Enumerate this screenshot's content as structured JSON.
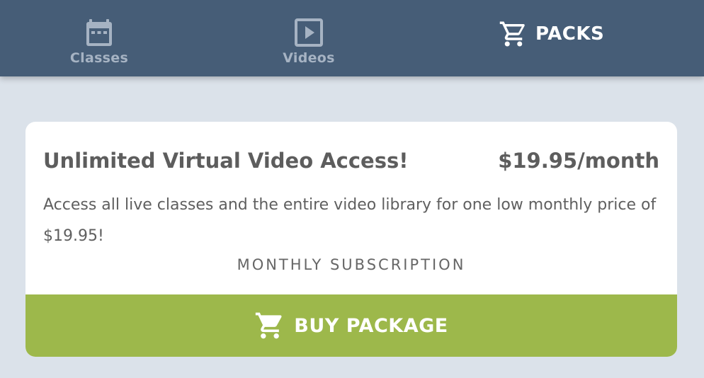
{
  "nav": {
    "items": [
      {
        "label": "Classes",
        "icon": "calendar-icon",
        "active": false
      },
      {
        "label": "Videos",
        "icon": "play-square-icon",
        "active": false
      },
      {
        "label": "PACKS",
        "icon": "cart-icon",
        "active": true
      }
    ],
    "bg_color": "#465d77",
    "inactive_color": "#a6b3c3",
    "active_color": "#ffffff"
  },
  "package": {
    "title": "Unlimited Virtual Video Access!",
    "price": "$19.95/month",
    "description": "Access all live classes and the entire video library for one low monthly price of $19.95!",
    "type": "MONTHLY SUBSCRIPTION",
    "buy_label": "BUY PACKAGE",
    "buy_icon": "cart-icon",
    "button_color": "#9db84b"
  },
  "page_bg": "#dbe2ea"
}
